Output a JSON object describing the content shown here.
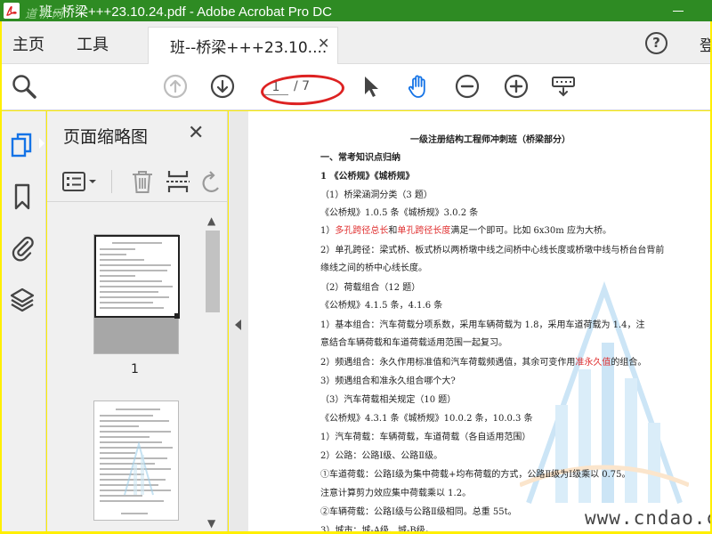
{
  "titlebar": {
    "title": "班--桥梁+++23.10.24.pdf - Adobe Acrobat Pro DC",
    "watermark": "道桥网"
  },
  "menu": {
    "home": "主页",
    "tools": "工具",
    "tab_label": "班--桥梁+++23.10....",
    "tab_close": "✕",
    "help": "?",
    "login": "登录"
  },
  "toolbar": {
    "page_current": "1",
    "page_total": "/ 7",
    "icons": [
      "zoom-search-icon",
      "prev-page-icon",
      "next-page-icon",
      "select-cursor-icon",
      "hand-icon",
      "zoom-out-icon",
      "zoom-in-icon",
      "more-tools-icon"
    ]
  },
  "colors": {
    "titlebar": "#2e8b23",
    "frame": "#ffef00",
    "accent_blue": "#1473e6",
    "highlight_red": "#e03030"
  },
  "thumbnails": {
    "title": "页面缩略图",
    "close": "✕",
    "page1_label": "1",
    "scroll_up": "▲",
    "scroll_down": "▼"
  },
  "document": {
    "title": "一级注册结构工程师冲刺班（桥梁部分）",
    "watermark": "www.cndao.com",
    "lines": [
      {
        "text": "一、常考知识点归纳",
        "bold": true
      },
      {
        "text": "1 《公桥规》《城桥规》",
        "bold": true
      },
      {
        "text": "（1）桥梁涵洞分类（3 题）"
      },
      {
        "text": "《公桥规》1.0.5 条《城桥规》3.0.2 条"
      },
      {
        "pre": "1）",
        "red1": "多孔跨径总长",
        "mid": "和",
        "red2": "单孔跨径长度",
        "post": "满足一个即可。比如 6x30m 应为大桥。"
      },
      {
        "text": "2）单孔跨径：梁式桥、板式桥以两桥墩中线之间桥中心线长度或桥墩中线与桥台台背前"
      },
      {
        "text": "缘线之间的桥中心线长度。"
      },
      {
        "text": "（2）荷载组合（12 题）"
      },
      {
        "text": "《公桥规》4.1.5 条，4.1.6 条"
      },
      {
        "text": "1）基本组合：汽车荷载分项系数，采用车辆荷载为 1.8，采用车道荷载为 1.4，注"
      },
      {
        "text": "意结合车辆荷载和车道荷载适用范围一起复习。"
      },
      {
        "pre": "2）频遇组合：永久作用标准值和汽车荷载频遇值，其余可变作用",
        "red1": "准永久值",
        "post": "的组合。"
      },
      {
        "text": "3）频遇组合和准永久组合哪个大?"
      },
      {
        "text": "（3）汽车荷载相关规定（10 题）"
      },
      {
        "text": "《公桥规》4.3.1 条《城桥规》10.0.2 条，10.0.3 条"
      },
      {
        "text": "1）汽车荷载：车辆荷载，车道荷载（各自适用范围）"
      },
      {
        "text": "2）公路：公路Ⅰ级、公路Ⅱ级。"
      },
      {
        "text": "①车道荷载：公路Ⅰ级为集中荷载+均布荷载的方式，公路Ⅱ级为Ⅰ级乘以 0.75。"
      },
      {
        "text": "注意计算剪力效应集中荷载乘以 1.2。"
      },
      {
        "text": "②车辆荷载：公路Ⅰ级与公路Ⅱ级相同。总重 55t。"
      },
      {
        "text": "3）城市：城-A级、城-B级。"
      }
    ]
  }
}
